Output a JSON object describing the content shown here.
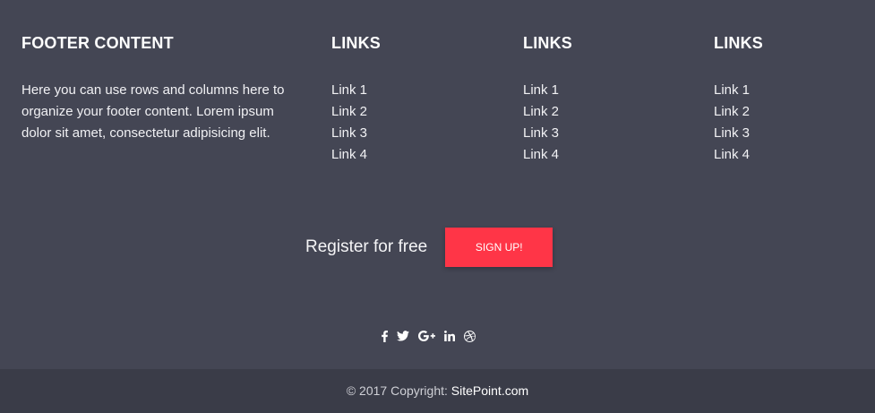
{
  "about": {
    "title": "FOOTER CONTENT",
    "text": "Here you can use rows and columns here to organize your footer content. Lorem ipsum dolor sit amet, consectetur adipisicing elit."
  },
  "link_columns": [
    {
      "title": "LINKS",
      "links": [
        "Link 1",
        "Link 2",
        "Link 3",
        "Link 4"
      ]
    },
    {
      "title": "LINKS",
      "links": [
        "Link 1",
        "Link 2",
        "Link 3",
        "Link 4"
      ]
    },
    {
      "title": "LINKS",
      "links": [
        "Link 1",
        "Link 2",
        "Link 3",
        "Link 4"
      ]
    }
  ],
  "register": {
    "text": "Register for free",
    "button_label": "SIGN UP!"
  },
  "social_icons": [
    "facebook-icon",
    "twitter-icon",
    "google-plus-icon",
    "linkedin-icon",
    "dribbble-icon"
  ],
  "copyright": {
    "prefix": "© 2017 Copyright: ",
    "link_text": "SitePoint.com"
  },
  "colors": {
    "background": "#444654",
    "copyright_background": "#3a3c48",
    "accent": "#ff3547",
    "text": "#ffffff"
  }
}
